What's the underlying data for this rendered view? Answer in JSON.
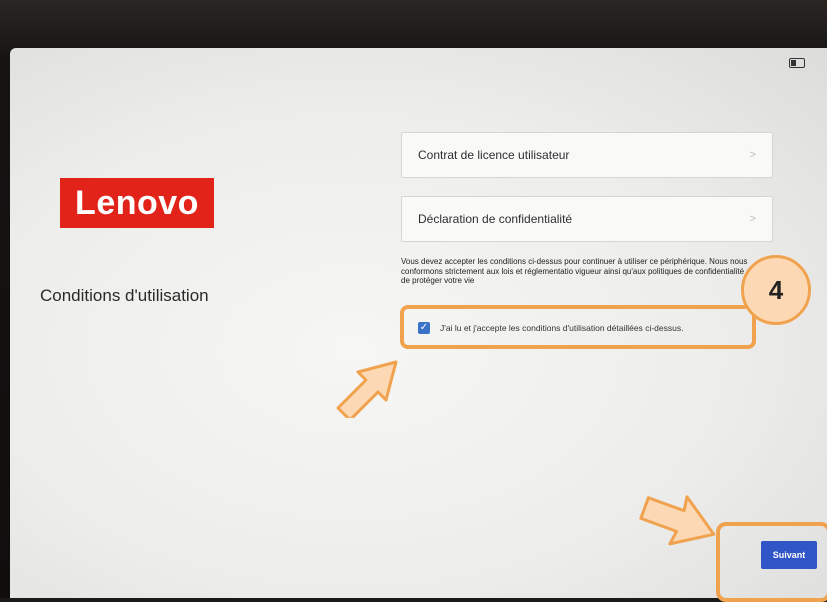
{
  "status_bar": {
    "icon": "battery-icon"
  },
  "brand": {
    "logo_text": "Lenovo",
    "color": "#e2231a"
  },
  "page": {
    "title": "Conditions d'utilisation"
  },
  "cards": [
    {
      "label": "Contrat de licence utilisateur",
      "icon": "chevron-right-icon",
      "chevron": ">"
    },
    {
      "label": "Déclaration de confidentialité",
      "icon": "chevron-right-icon",
      "chevron": ">"
    }
  ],
  "notice": {
    "text": "Vous devez accepter les conditions ci-dessus pour continuer à utiliser ce périphérique. Nous nous conformons strictement aux lois et réglementatio vigueur ainsi qu'aux politiques de confidentialité afin de protéger votre vie"
  },
  "agreement": {
    "checked": true,
    "check_glyph": "✓",
    "label": "J'ai lu et j'accepte les conditions d'utilisation détaillées ci-dessus."
  },
  "footer": {
    "next_label": "Suivant",
    "accent": "#2f55c7"
  },
  "annotation": {
    "step": "4",
    "color": "#f0a24f"
  }
}
